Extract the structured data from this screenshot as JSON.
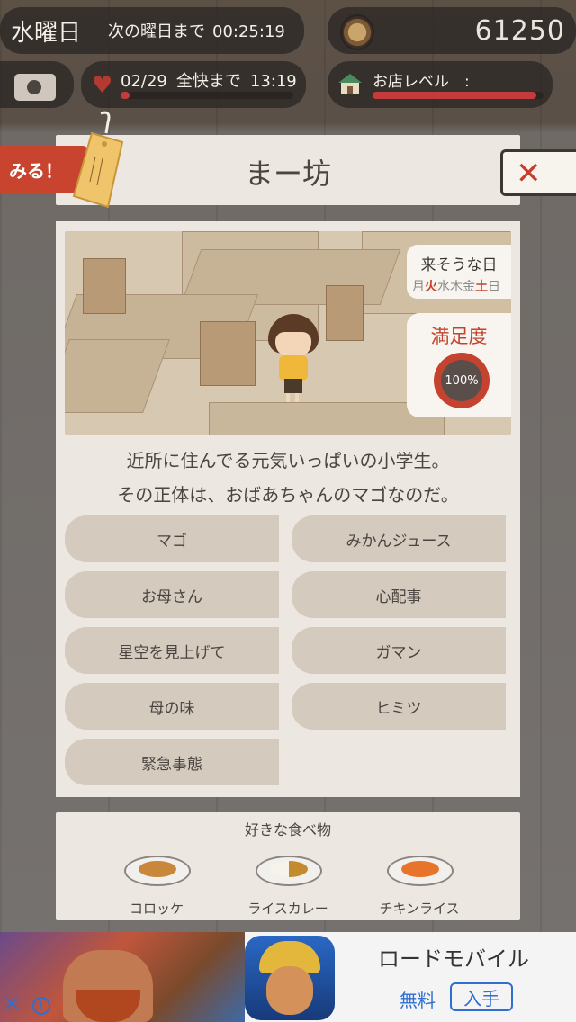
{
  "hud": {
    "day": "水曜日",
    "next_day_label": "次の曜日まで",
    "next_day_time": "00:25:19",
    "coins": "61250",
    "heart_date": "02/29",
    "heart_label": "全快まで",
    "heart_time": "13:19",
    "heart_progress": 0.05,
    "shop_label": "お店レベル　:",
    "shop_progress": 0.96
  },
  "panel": {
    "miru_label": "みる！",
    "title": "まー坊",
    "likely_day_title": "来そうな日",
    "days": [
      {
        "label": "月",
        "on": false
      },
      {
        "label": "火",
        "on": true
      },
      {
        "label": "水",
        "on": false
      },
      {
        "label": "木",
        "on": false
      },
      {
        "label": "金",
        "on": false
      },
      {
        "label": "土",
        "on": true
      },
      {
        "label": "日",
        "on": false
      }
    ],
    "satisfaction_title": "満足度",
    "satisfaction_value": "100%",
    "description_line1": "近所に住んでる元気いっぱいの小学生。",
    "description_line2": "その正体は、おばあちゃんのマゴなのだ。",
    "episodes": [
      "マゴ",
      "みかんジュース",
      "お母さん",
      "心配事",
      "星空を見上げて",
      "ガマン",
      "母の味",
      "ヒミツ",
      "緊急事態"
    ],
    "favorite_food_title": "好きな食べ物",
    "foods": [
      "コロッケ",
      "ライスカレー",
      "チキンライス"
    ]
  },
  "ad": {
    "title": "ロードモバイル",
    "free_label": "無料",
    "install_label": "入手",
    "close_symbol": "✕",
    "info_symbol": "i"
  },
  "colors": {
    "accent_red": "#c5432e",
    "panel_bg": "#ece8e1",
    "button_bg": "#d4cabd",
    "link_blue": "#2f6fd0"
  }
}
